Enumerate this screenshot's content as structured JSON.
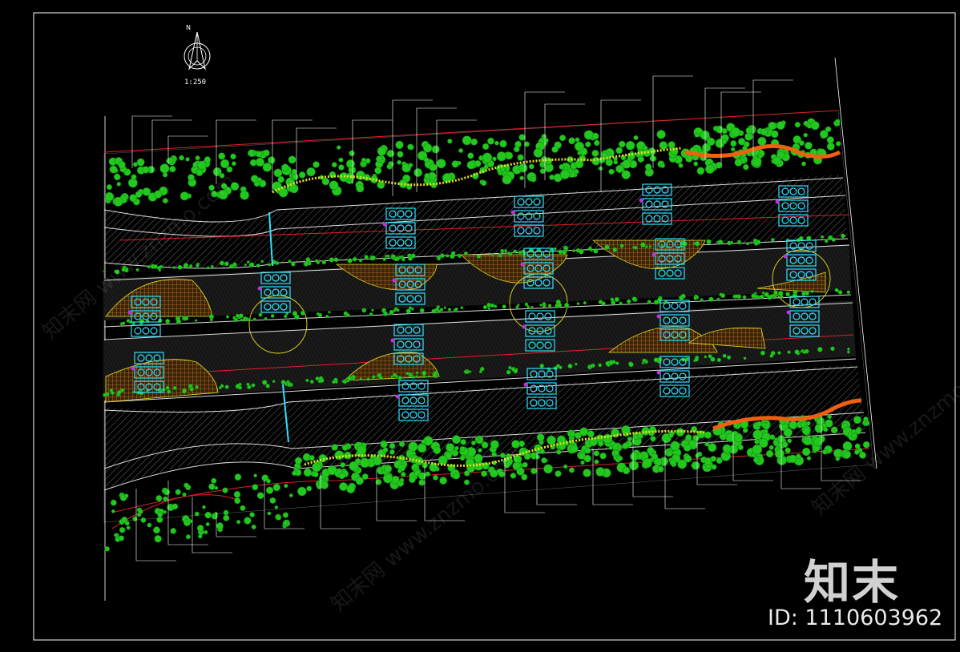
{
  "drawing": {
    "north_label": "N",
    "scale_text": "1:250",
    "colors": {
      "background": "#000000",
      "frame": "#ffffff",
      "tree": "#22c81e",
      "tree_dark": "#0f7a10",
      "leader": "#ffffff",
      "redline": "#e0202a",
      "yellow": "#e8e020",
      "orange": "#f06010",
      "plaza_hatch": "#c87a30",
      "cyan": "#30e0ff",
      "magenta": "#c030e0"
    }
  },
  "watermark": {
    "brand": "知末",
    "id_text": "ID: 1110603962",
    "faint_text": "知末网 www.znzmo.com"
  }
}
